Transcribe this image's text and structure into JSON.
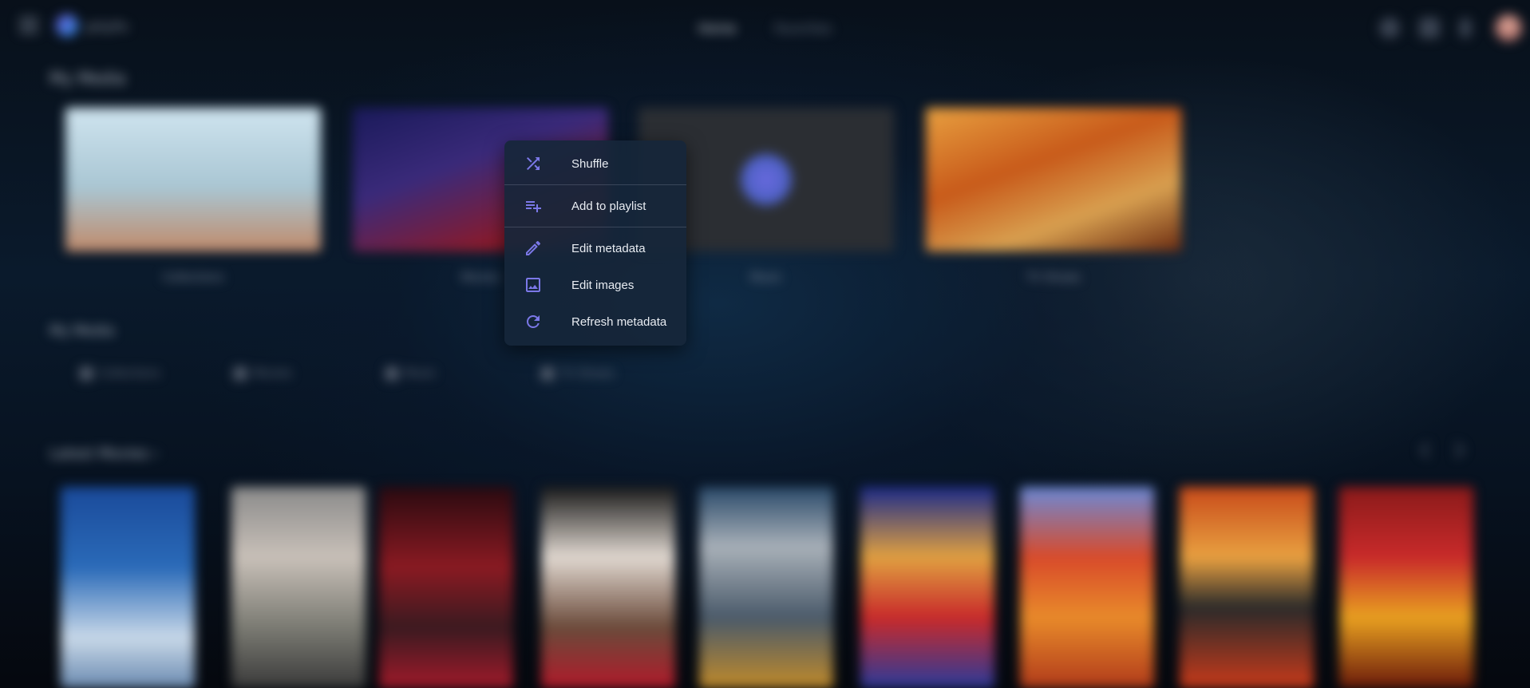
{
  "header": {
    "brand": "Jellyfin",
    "tabs": [
      {
        "label": "Home"
      },
      {
        "label": "Favorites"
      }
    ]
  },
  "sections": {
    "my_media": "My Media",
    "my_media_small": "My Media",
    "latest_movies": "Latest Movies ›"
  },
  "libraries": [
    {
      "label": "Collections"
    },
    {
      "label": "Movies"
    },
    {
      "label": "Music"
    },
    {
      "label": "TV Shows"
    }
  ],
  "quick_buttons": [
    {
      "label": "Collections"
    },
    {
      "label": "Movies"
    },
    {
      "label": "Music"
    },
    {
      "label": "TV Shows"
    }
  ],
  "context_menu": {
    "items": [
      {
        "label": "Shuffle",
        "icon": "shuffle-icon"
      },
      {
        "label": "Add to playlist",
        "icon": "playlist-add-icon"
      },
      {
        "label": "Edit metadata",
        "icon": "pencil-icon"
      },
      {
        "label": "Edit images",
        "icon": "image-icon"
      },
      {
        "label": "Refresh metadata",
        "icon": "refresh-icon"
      }
    ]
  },
  "colors": {
    "menu_icon": "#7b78e8",
    "menu_bg": "#16263a",
    "menu_text": "#e8ecf2"
  }
}
